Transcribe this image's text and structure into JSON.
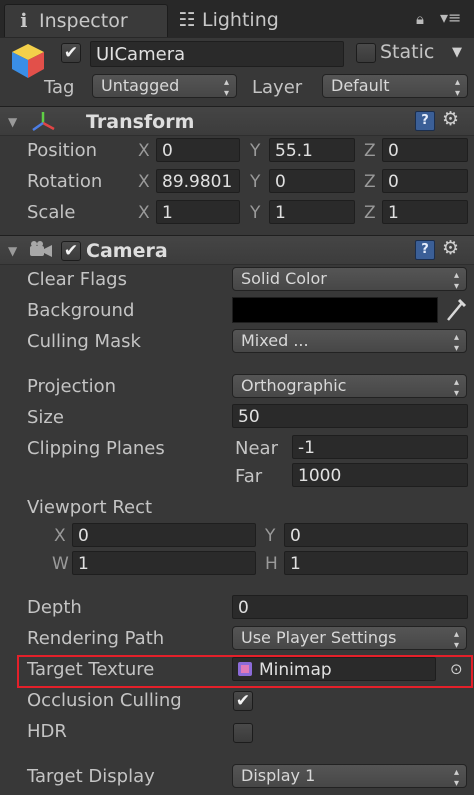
{
  "tabs": [
    {
      "label": "Inspector",
      "icon": "info-icon"
    },
    {
      "label": "Lighting",
      "icon": "sliders-icon"
    }
  ],
  "header": {
    "object_name": "UICamera",
    "active_checked": true,
    "static_label": "Static",
    "tag_label": "Tag",
    "tag_value": "Untagged",
    "layer_label": "Layer",
    "layer_value": "Default"
  },
  "transform": {
    "title": "Transform",
    "position_label": "Position",
    "rotation_label": "Rotation",
    "scale_label": "Scale",
    "axis_x": "X",
    "axis_y": "Y",
    "axis_z": "Z",
    "position": {
      "x": "0",
      "y": "55.1",
      "z": "0"
    },
    "rotation": {
      "x": "89.9801",
      "y": "0",
      "z": "0"
    },
    "scale": {
      "x": "1",
      "y": "1",
      "z": "1"
    }
  },
  "camera": {
    "title": "Camera",
    "enabled": true,
    "clear_flags_label": "Clear Flags",
    "clear_flags_value": "Solid Color",
    "background_label": "Background",
    "background_color": "#000000",
    "culling_mask_label": "Culling Mask",
    "culling_mask_value": "Mixed ...",
    "projection_label": "Projection",
    "projection_value": "Orthographic",
    "size_label": "Size",
    "size_value": "50",
    "clipping_planes_label": "Clipping Planes",
    "near_label": "Near",
    "near_value": "-1",
    "far_label": "Far",
    "far_value": "1000",
    "viewport_rect_label": "Viewport Rect",
    "vp_x_label": "X",
    "vp_y_label": "Y",
    "vp_w_label": "W",
    "vp_h_label": "H",
    "vp_x": "0",
    "vp_y": "0",
    "vp_w": "1",
    "vp_h": "1",
    "depth_label": "Depth",
    "depth_value": "0",
    "rendering_path_label": "Rendering Path",
    "rendering_path_value": "Use Player Settings",
    "target_texture_label": "Target Texture",
    "target_texture_value": "Minimap",
    "occlusion_culling_label": "Occlusion Culling",
    "occlusion_culling_checked": true,
    "hdr_label": "HDR",
    "hdr_checked": false,
    "target_display_label": "Target Display",
    "target_display_value": "Display 1"
  },
  "colors": {
    "highlight": "#e4202a",
    "help_button": "#3b5f97"
  }
}
